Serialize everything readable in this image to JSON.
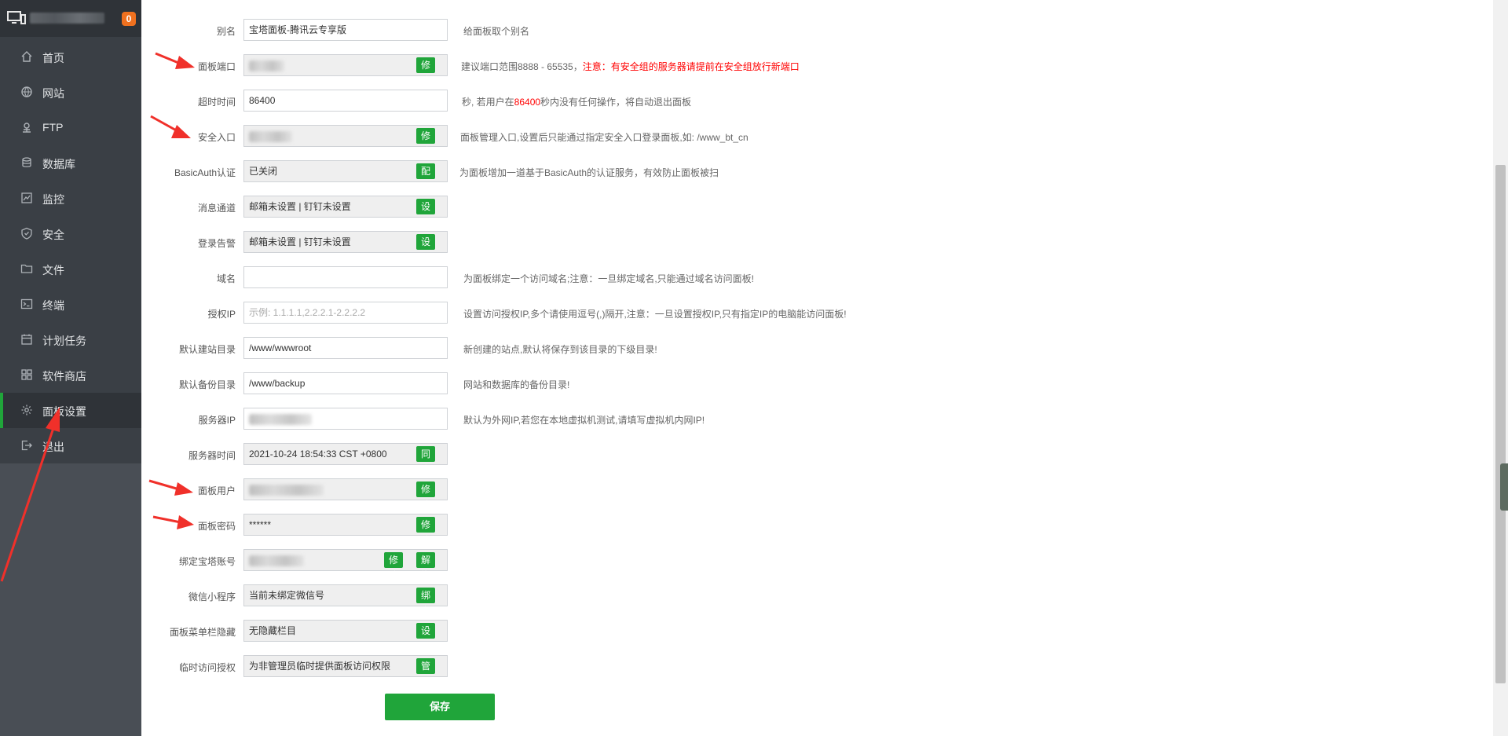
{
  "sidebar": {
    "badge": "0",
    "items": [
      {
        "label": "首页",
        "icon": "home-icon"
      },
      {
        "label": "网站",
        "icon": "globe-icon"
      },
      {
        "label": "FTP",
        "icon": "ftp-icon"
      },
      {
        "label": "数据库",
        "icon": "database-icon"
      },
      {
        "label": "监控",
        "icon": "monitor-icon"
      },
      {
        "label": "安全",
        "icon": "shield-icon"
      },
      {
        "label": "文件",
        "icon": "folder-icon"
      },
      {
        "label": "终端",
        "icon": "terminal-icon"
      },
      {
        "label": "计划任务",
        "icon": "calendar-icon"
      },
      {
        "label": "软件商店",
        "icon": "apps-icon"
      },
      {
        "label": "面板设置",
        "icon": "gear-icon"
      },
      {
        "label": "退出",
        "icon": "logout-icon"
      }
    ]
  },
  "settings": {
    "alias": {
      "label": "别名",
      "value": "宝塔面板-腾讯云专享版",
      "desc": "给面板取个别名"
    },
    "port": {
      "label": "面板端口",
      "button": "修改",
      "desc": "建议端口范围8888 - 65535，",
      "desc_warn": "注意：有安全组的服务器请提前在安全组放行新端口"
    },
    "timeout": {
      "label": "超时时间",
      "value": "86400",
      "desc_pre": "秒, 若用户在",
      "desc_num": "86400",
      "desc_post": "秒内没有任何操作，将自动退出面板"
    },
    "entry": {
      "label": "安全入口",
      "button": "修改",
      "desc": "面板管理入口,设置后只能通过指定安全入口登录面板,如: /www_bt_cn"
    },
    "basicauth": {
      "label": "BasicAuth认证",
      "value": "已关闭",
      "button": "配置",
      "desc": "为面板增加一道基于BasicAuth的认证服务，有效防止面板被扫"
    },
    "message": {
      "label": "消息通道",
      "value": "邮箱未设置 | 钉钉未设置",
      "button": "设置"
    },
    "login_alert": {
      "label": "登录告警",
      "value": "邮箱未设置 | 钉钉未设置",
      "button": "设置"
    },
    "domain": {
      "label": "域名",
      "value": "",
      "desc": "为面板绑定一个访问域名;注意：一旦绑定域名,只能通过域名访问面板!"
    },
    "auth_ip": {
      "label": "授权IP",
      "placeholder": "示例: 1.1.1.1,2.2.2.1-2.2.2.2",
      "desc": "设置访问授权IP,多个请使用逗号(,)隔开,注意：一旦设置授权IP,只有指定IP的电脑能访问面板!"
    },
    "site_dir": {
      "label": "默认建站目录",
      "value": "/www/wwwroot",
      "desc": "新创建的站点,默认将保存到该目录的下级目录!"
    },
    "backup_dir": {
      "label": "默认备份目录",
      "value": "/www/backup",
      "desc": "网站和数据库的备份目录!"
    },
    "server_ip": {
      "label": "服务器IP",
      "desc": "默认为外网IP,若您在本地虚拟机测试,请填写虚拟机内网IP!"
    },
    "server_time": {
      "label": "服务器时间",
      "value": "2021-10-24 18:54:33 CST +0800",
      "button": "同步"
    },
    "panel_user": {
      "label": "面板用户",
      "button": "修改"
    },
    "panel_pass": {
      "label": "面板密码",
      "value": "******",
      "button": "修改"
    },
    "bt_account": {
      "label": "绑定宝塔账号",
      "button_edit": "修改",
      "button_unbind": "解绑"
    },
    "wechat": {
      "label": "微信小程序",
      "value": "当前未绑定微信号",
      "button": "绑定"
    },
    "menu_hide": {
      "label": "面板菜单栏隐藏",
      "value": "无隐藏栏目",
      "button": "设置"
    },
    "temp_access": {
      "label": "临时访问授权",
      "value": "为非管理员临时提供面板访问权限",
      "button": "管理"
    }
  },
  "save_label": "保存",
  "colors": {
    "accent": "#20a53a",
    "sidebar": "#3a3f45",
    "warning": "#ff0000",
    "arrow": "#f0302a"
  }
}
